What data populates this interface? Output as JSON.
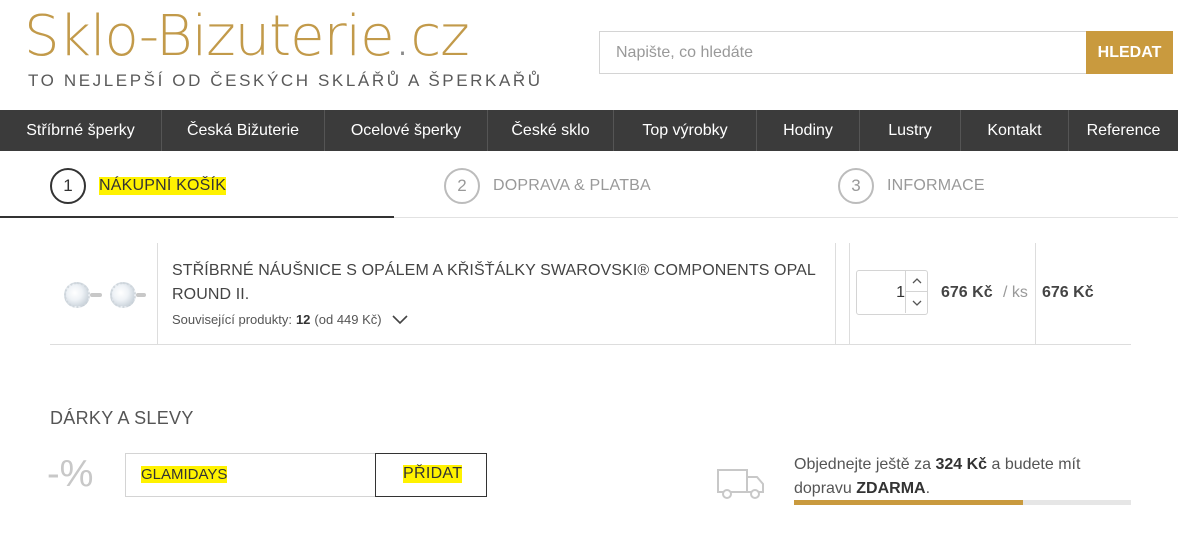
{
  "header": {
    "logo_part1": "Sklo-Bizuterie",
    "logo_part2": "cz",
    "tagline": "TO NEJLEPŠÍ OD ČESKÝCH SKLÁŘŮ A ŠPERKAŘŮ",
    "search_placeholder": "Napište, co hledáte",
    "search_button": "HLEDAT"
  },
  "nav": {
    "items": [
      {
        "label": "Stříbrné šperky"
      },
      {
        "label": "Česká Bižuterie"
      },
      {
        "label": "Ocelové šperky"
      },
      {
        "label": "České sklo"
      },
      {
        "label": "Top výrobky"
      },
      {
        "label": "Hodiny"
      },
      {
        "label": "Lustry"
      },
      {
        "label": "Kontakt"
      },
      {
        "label": "Reference"
      }
    ]
  },
  "steps": [
    {
      "number": "1",
      "label": "NÁKUPNÍ KOŠÍK",
      "active": true
    },
    {
      "number": "2",
      "label": "DOPRAVA & PLATBA",
      "active": false
    },
    {
      "number": "3",
      "label": "INFORMACE",
      "active": false
    }
  ],
  "cart": {
    "item": {
      "name_line1": "STŘÍBRNÉ NÁUŠNICE S OPÁLEM A KŘIŠŤÁLKY SWAROVSKI® COMPONENTS OPAL",
      "name_line2": "ROUND II.",
      "related_label": "Související produkty:",
      "related_count": "12",
      "related_from": "(od 449 Kč)",
      "quantity": "1",
      "unit_price": "676 Kč",
      "per_unit": "/ ks",
      "total_price": "676 Kč"
    }
  },
  "gifts": {
    "title": "DÁRKY A SLEVY",
    "percent_sign": "-%",
    "coupon_value": "GLAMIDAYS",
    "add_button": "PŘIDAT"
  },
  "shipping": {
    "text_before": "Objednejte ještě za",
    "amount": "324 Kč",
    "text_middle": "a budete mít",
    "text_line2": "dopravu",
    "free_label": "ZDARMA",
    "period": ".",
    "progress_fraction": 0.68
  },
  "colors": {
    "accent": "#c99a3e",
    "nav_bg": "#3b3b3b",
    "highlight": "#fff200"
  }
}
